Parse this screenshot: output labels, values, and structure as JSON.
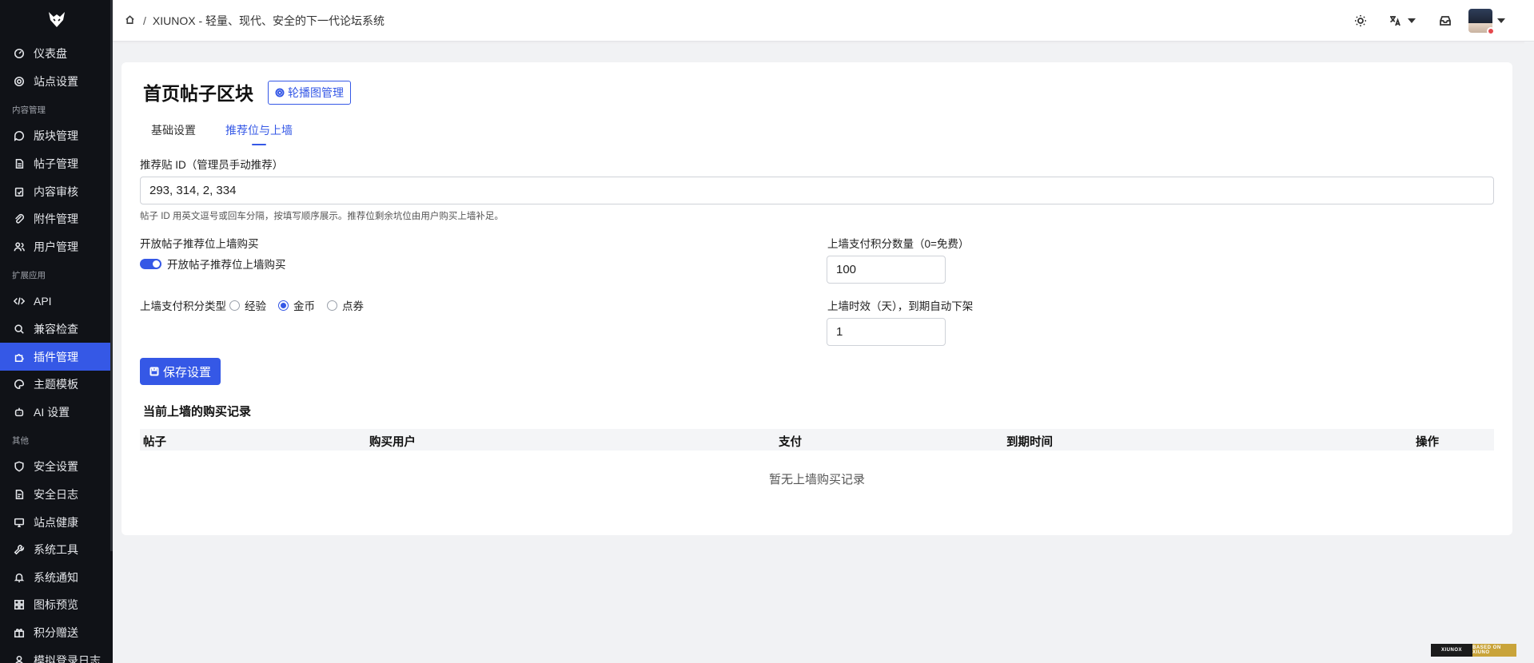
{
  "sidebar": {
    "items": [
      {
        "label": "仪表盘",
        "icon": "dashboard-icon"
      },
      {
        "label": "站点设置",
        "icon": "gear-icon"
      },
      {
        "section": "内容管理"
      },
      {
        "label": "版块管理",
        "icon": "chat-bubble-icon"
      },
      {
        "label": "帖子管理",
        "icon": "document-icon"
      },
      {
        "label": "内容审核",
        "icon": "clipboard-check-icon"
      },
      {
        "label": "附件管理",
        "icon": "paperclip-icon"
      },
      {
        "label": "用户管理",
        "icon": "users-icon"
      },
      {
        "section": "扩展应用"
      },
      {
        "label": "API",
        "icon": "code-icon"
      },
      {
        "label": "兼容检查",
        "icon": "search-icon"
      },
      {
        "label": "插件管理",
        "icon": "puzzle-icon",
        "active": true
      },
      {
        "label": "主题模板",
        "icon": "palette-icon"
      },
      {
        "label": "AI 设置",
        "icon": "robot-icon"
      },
      {
        "section": "其他"
      },
      {
        "label": "安全设置",
        "icon": "shield-icon"
      },
      {
        "label": "安全日志",
        "icon": "log-icon"
      },
      {
        "label": "站点健康",
        "icon": "monitor-icon"
      },
      {
        "label": "系统工具",
        "icon": "wrench-icon"
      },
      {
        "label": "系统通知",
        "icon": "bell-icon"
      },
      {
        "label": "图标预览",
        "icon": "grid-icon"
      },
      {
        "label": "积分赠送",
        "icon": "gift-icon"
      },
      {
        "label": "模拟登录日志",
        "icon": "user-icon"
      }
    ]
  },
  "topbar": {
    "breadcrumb_sep": "/",
    "site_title": "XIUNOX - 轻量、现代、安全的下一代论坛系统"
  },
  "page": {
    "title": "首页帖子区块",
    "carousel_button": "轮播图管理",
    "tabs": [
      {
        "label": "基础设置",
        "active": false
      },
      {
        "label": "推荐位与上墙",
        "active": true
      }
    ],
    "recommend_label": "推荐贴 ID（管理员手动推荐）",
    "recommend_value": "293, 314, 2, 334",
    "recommend_hint": "帖子 ID 用英文逗号或回车分隔，按填写顺序展示。推荐位剩余坑位由用户购买上墙补足。",
    "open_purchase_label": "开放帖子推荐位上墙购买",
    "open_purchase_toggle_label": "开放帖子推荐位上墙购买",
    "open_purchase_on": true,
    "pay_amount_label": "上墙支付积分数量（0=免费）",
    "pay_amount_value": "100",
    "pay_type_label": "上墙支付积分类型",
    "pay_types": [
      {
        "label": "经验",
        "checked": false
      },
      {
        "label": "金币",
        "checked": true
      },
      {
        "label": "点券",
        "checked": false
      }
    ],
    "duration_label": "上墙时效（天），到期自动下架",
    "duration_value": "1",
    "save_button": "保存设置",
    "records_title": "当前上墙的购买记录",
    "table_headers": [
      "帖子",
      "购买用户",
      "支付",
      "到期时间",
      "操作"
    ],
    "empty_text": "暂无上墙购买记录"
  },
  "footer_badge": {
    "left": "XIUNOX",
    "right": "BASED ON XIUNO"
  },
  "colors": {
    "accent": "#3558e6",
    "sidebar_bg": "#101217"
  }
}
